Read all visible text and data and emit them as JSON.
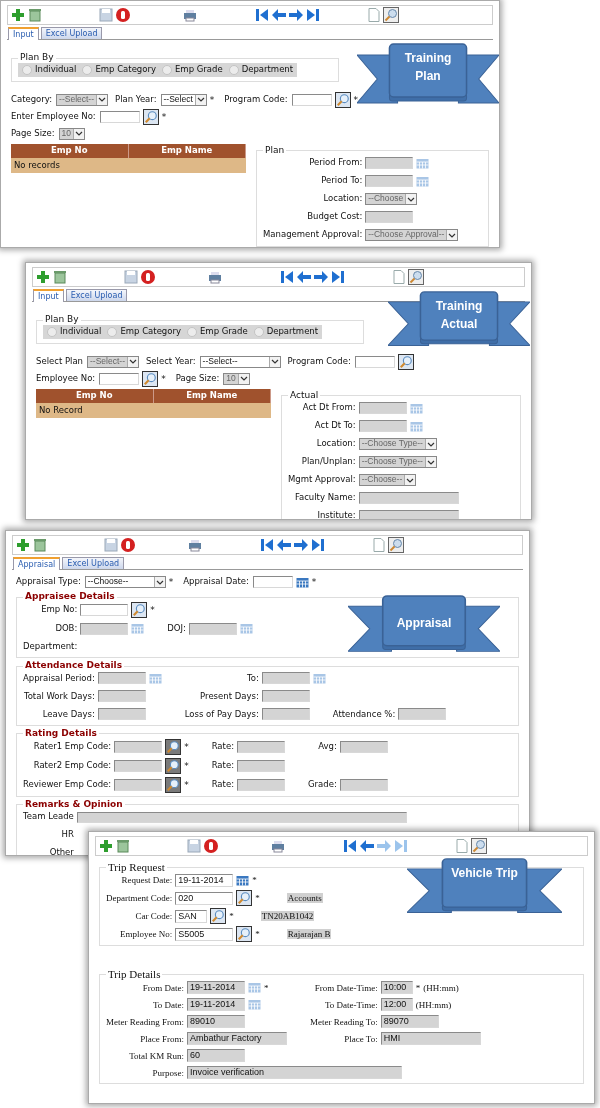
{
  "windows": [
    {
      "kind": "standard",
      "toolbar": {
        "forward_enabled": true
      },
      "tabs": [
        {
          "label": "Input",
          "selected": true
        },
        {
          "label": "Excel Upload",
          "selected": false
        }
      ],
      "ribbon": "Training Plan",
      "blocks": [
        {
          "kind": "radio-group",
          "legend": "Plan By",
          "options": [
            {
              "label": "Individual",
              "selected": false
            },
            {
              "label": "Emp Category",
              "selected": false
            },
            {
              "label": "Emp Grade",
              "selected": false
            },
            {
              "label": "Department",
              "selected": false
            }
          ]
        },
        {
          "kind": "line",
          "items": [
            {
              "kind": "label",
              "text": "Category:"
            },
            {
              "kind": "select",
              "value": "--Select--",
              "disabled": true
            },
            {
              "kind": "label",
              "text": "Plan Year:"
            },
            {
              "kind": "select",
              "value": "--Select",
              "disabled": false
            },
            {
              "kind": "mark",
              "text": "*"
            },
            {
              "kind": "label",
              "text": "Program Code:"
            },
            {
              "kind": "input",
              "disabled": false
            },
            {
              "kind": "lookup",
              "disabled": false
            },
            {
              "kind": "mark",
              "text": "*"
            }
          ]
        },
        {
          "kind": "line",
          "items": [
            {
              "kind": "label",
              "text": "Enter Employee No:"
            },
            {
              "kind": "input",
              "disabled": false
            },
            {
              "kind": "lookup",
              "disabled": false
            },
            {
              "kind": "mark",
              "text": "*"
            }
          ]
        },
        {
          "kind": "line",
          "items": [
            {
              "kind": "label",
              "text": "Page Size:"
            },
            {
              "kind": "select",
              "value": "10",
              "disabled": true
            }
          ]
        },
        {
          "kind": "split",
          "left": [
            {
              "kind": "grid",
              "columns": [
                "Emp No",
                "Emp Name"
              ],
              "empty_text": "No records"
            }
          ],
          "right": [
            {
              "kind": "fieldset",
              "legend": "Plan",
              "rows": [
                [
                  {
                    "label": "Period From:",
                    "items": [
                      {
                        "kind": "input",
                        "disabled": true
                      },
                      {
                        "kind": "calendar",
                        "disabled": true
                      }
                    ]
                  }
                ],
                [
                  {
                    "label": "Period To:",
                    "items": [
                      {
                        "kind": "input",
                        "disabled": true
                      },
                      {
                        "kind": "calendar",
                        "disabled": true
                      }
                    ]
                  }
                ],
                [
                  {
                    "label": "Location:",
                    "items": [
                      {
                        "kind": "select",
                        "value": "--Choose",
                        "disabled": true
                      }
                    ]
                  }
                ],
                [
                  {
                    "label": "Budget Cost:",
                    "items": [
                      {
                        "kind": "input",
                        "disabled": true
                      }
                    ]
                  }
                ],
                [
                  {
                    "label": "Management Approval:",
                    "items": [
                      {
                        "kind": "select",
                        "value": "--Choose Approval--",
                        "disabled": true
                      }
                    ]
                  }
                ]
              ]
            }
          ]
        }
      ]
    },
    {
      "kind": "standard",
      "toolbar": {
        "forward_enabled": true
      },
      "tabs": [
        {
          "label": "Input",
          "selected": true
        },
        {
          "label": "Excel Upload",
          "selected": false
        }
      ],
      "ribbon": "Training Actual",
      "blocks": [
        {
          "kind": "radio-group",
          "legend": "Plan By",
          "options": [
            {
              "label": "Individual",
              "selected": false
            },
            {
              "label": "Emp Category",
              "selected": false
            },
            {
              "label": "Emp Grade",
              "selected": false
            },
            {
              "label": "Department",
              "selected": false
            }
          ]
        },
        {
          "kind": "line",
          "items": [
            {
              "kind": "label",
              "text": "Select Plan"
            },
            {
              "kind": "select",
              "value": "--Select--",
              "disabled": true
            },
            {
              "kind": "label",
              "text": "Select Year:"
            },
            {
              "kind": "wide-select",
              "value": "--Select--",
              "disabled": false
            },
            {
              "kind": "label",
              "text": "Program Code:"
            },
            {
              "kind": "input",
              "disabled": false
            },
            {
              "kind": "lookup",
              "disabled": false
            }
          ]
        },
        {
          "kind": "line",
          "items": [
            {
              "kind": "label",
              "text": "Employee No:"
            },
            {
              "kind": "input",
              "disabled": false
            },
            {
              "kind": "lookup",
              "disabled": false
            },
            {
              "kind": "mark",
              "text": "*"
            },
            {
              "kind": "label",
              "text": "Page Size:"
            },
            {
              "kind": "select",
              "value": "10",
              "disabled": true
            }
          ]
        },
        {
          "kind": "split",
          "left": [
            {
              "kind": "grid",
              "columns": [
                "Emp No",
                "Emp Name"
              ],
              "empty_text": "No Record"
            }
          ],
          "right": [
            {
              "kind": "fieldset",
              "legend": "Actual",
              "rows": [
                [
                  {
                    "label": "Act Dt From:",
                    "items": [
                      {
                        "kind": "input",
                        "disabled": true
                      },
                      {
                        "kind": "calendar",
                        "disabled": true
                      }
                    ]
                  }
                ],
                [
                  {
                    "label": "Act Dt To:",
                    "items": [
                      {
                        "kind": "input",
                        "disabled": true
                      },
                      {
                        "kind": "calendar",
                        "disabled": true
                      }
                    ]
                  }
                ],
                [
                  {
                    "label": "Location:",
                    "items": [
                      {
                        "kind": "select",
                        "value": "--Choose Type--",
                        "disabled": true
                      }
                    ]
                  }
                ],
                [
                  {
                    "label": "Plan/Unplan:",
                    "items": [
                      {
                        "kind": "select",
                        "value": "--Choose Type--",
                        "disabled": true
                      }
                    ]
                  }
                ],
                [
                  {
                    "label": "Mgmt Approval:",
                    "items": [
                      {
                        "kind": "select",
                        "value": "--Choose--",
                        "disabled": true
                      }
                    ]
                  }
                ],
                [
                  {
                    "label": "Faculty Name:",
                    "items": [
                      {
                        "kind": "wide-input",
                        "disabled": true
                      }
                    ]
                  }
                ],
                [
                  {
                    "label": "Institute:",
                    "items": [
                      {
                        "kind": "wide-input",
                        "disabled": true
                      }
                    ]
                  }
                ]
              ]
            }
          ]
        }
      ]
    },
    {
      "kind": "standard",
      "toolbar": {
        "forward_enabled": true
      },
      "tabs": [
        {
          "label": "Appraisal",
          "selected": true
        },
        {
          "label": "Excel Upload",
          "selected": false
        }
      ],
      "ribbon": "Appraisal",
      "blocks": [
        {
          "kind": "line",
          "items": [
            {
              "kind": "label",
              "text": "Appraisal Type:"
            },
            {
              "kind": "wide-select",
              "value": "--Choose--",
              "disabled": false
            },
            {
              "kind": "mark",
              "text": "*"
            },
            {
              "kind": "label",
              "text": "Appraisal Date:"
            },
            {
              "kind": "input",
              "disabled": false
            },
            {
              "kind": "calendar",
              "disabled": false
            },
            {
              "kind": "mark",
              "text": "*"
            }
          ]
        },
        {
          "kind": "section",
          "legend": "Appraisee Details",
          "rows": [
            [
              {
                "label": "Emp No:",
                "items": [
                  {
                    "kind": "input",
                    "disabled": false
                  },
                  {
                    "kind": "lookup",
                    "disabled": false
                  },
                  {
                    "kind": "mark",
                    "text": "*"
                  }
                ]
              }
            ],
            [
              {
                "label": "DOB:",
                "items": [
                  {
                    "kind": "input",
                    "disabled": true
                  },
                  {
                    "kind": "calendar",
                    "disabled": true
                  }
                ]
              },
              {
                "label": "DOJ:",
                "items": [
                  {
                    "kind": "input",
                    "disabled": true
                  },
                  {
                    "kind": "calendar",
                    "disabled": true
                  }
                ]
              }
            ],
            [
              {
                "label": "Department:"
              }
            ]
          ]
        },
        {
          "kind": "section",
          "legend": "Attendance Details",
          "rows": [
            [
              {
                "label": "Appraisal Period:",
                "items": [
                  {
                    "kind": "input",
                    "disabled": true
                  },
                  {
                    "kind": "calendar",
                    "disabled": true
                  }
                ]
              },
              {
                "label": "To:",
                "items": [
                  {
                    "kind": "input",
                    "disabled": true
                  },
                  {
                    "kind": "calendar",
                    "disabled": true
                  }
                ]
              }
            ],
            [
              {
                "label": "Total Work Days:",
                "items": [
                  {
                    "kind": "input",
                    "disabled": true
                  }
                ]
              },
              {
                "label": "Present Days:",
                "items": [
                  {
                    "kind": "input",
                    "disabled": true
                  }
                ]
              }
            ],
            [
              {
                "label": "Leave Days:",
                "items": [
                  {
                    "kind": "input",
                    "disabled": true
                  }
                ]
              },
              {
                "label": "Loss of Pay Days:",
                "items": [
                  {
                    "kind": "input",
                    "disabled": true
                  }
                ]
              },
              {
                "label": "Attendance %:",
                "items": [
                  {
                    "kind": "input",
                    "disabled": true
                  }
                ]
              }
            ]
          ]
        },
        {
          "kind": "section",
          "legend": "Rating Details",
          "rows": [
            [
              {
                "label": "Rater1 Emp Code:",
                "items": [
                  {
                    "kind": "input",
                    "disabled": true
                  },
                  {
                    "kind": "lookup",
                    "disabled": true
                  },
                  {
                    "kind": "mark",
                    "text": "*"
                  }
                ]
              },
              {
                "label": "Rate:",
                "items": [
                  {
                    "kind": "input",
                    "disabled": true
                  }
                ]
              },
              {
                "label": "Avg:",
                "items": [
                  {
                    "kind": "input",
                    "disabled": true
                  }
                ]
              }
            ],
            [
              {
                "label": "Rater2 Emp Code:",
                "items": [
                  {
                    "kind": "input",
                    "disabled": true
                  },
                  {
                    "kind": "lookup",
                    "disabled": true
                  },
                  {
                    "kind": "mark",
                    "text": "*"
                  }
                ]
              },
              {
                "label": "Rate:",
                "items": [
                  {
                    "kind": "input",
                    "disabled": true
                  }
                ]
              }
            ],
            [
              {
                "label": "Reviewer Emp Code:",
                "items": [
                  {
                    "kind": "input",
                    "disabled": true
                  },
                  {
                    "kind": "lookup",
                    "disabled": true
                  },
                  {
                    "kind": "mark",
                    "text": "*"
                  }
                ]
              },
              {
                "label": "Rate:",
                "items": [
                  {
                    "kind": "input",
                    "disabled": true
                  }
                ]
              },
              {
                "label": "Grade:",
                "items": [
                  {
                    "kind": "input",
                    "disabled": true
                  }
                ]
              }
            ]
          ]
        },
        {
          "kind": "section",
          "legend": "Remarks & Opinion",
          "rows": [
            [
              {
                "label": "Team Leade",
                "items": [
                  {
                    "kind": "full-input",
                    "disabled": true
                  }
                ]
              }
            ],
            [
              {
                "label": "HR"
              }
            ],
            [
              {
                "label": "Other"
              }
            ]
          ]
        }
      ]
    },
    {
      "kind": "legacy",
      "toolbar": {
        "forward_enabled": false
      },
      "ribbon": "Vehicle Trip",
      "blocks": [
        {
          "kind": "fieldset",
          "legend": "Trip Request",
          "rows": [
            [
              {
                "label": "Request Date:",
                "items": [
                  {
                    "kind": "input",
                    "value": "19-11-2014",
                    "disabled": false
                  },
                  {
                    "kind": "calendar",
                    "disabled": false
                  },
                  {
                    "kind": "mark",
                    "text": "*"
                  }
                ]
              }
            ],
            [
              {
                "label": "Department Code:",
                "items": [
                  {
                    "kind": "input",
                    "value": "020",
                    "disabled": false
                  },
                  {
                    "kind": "lookup",
                    "disabled": false
                  },
                  {
                    "kind": "mark",
                    "text": "*"
                  },
                  {
                    "kind": "display",
                    "text": "Accounts"
                  }
                ]
              }
            ],
            [
              {
                "label": "Car Code:",
                "items": [
                  {
                    "kind": "short-input",
                    "value": "SAN",
                    "disabled": false
                  },
                  {
                    "kind": "lookup",
                    "disabled": false
                  },
                  {
                    "kind": "mark",
                    "text": "*"
                  },
                  {
                    "kind": "display",
                    "text": "TN20AB1042"
                  }
                ]
              }
            ],
            [
              {
                "label": "Employee No:",
                "items": [
                  {
                    "kind": "input",
                    "value": "S5005",
                    "disabled": false
                  },
                  {
                    "kind": "lookup",
                    "disabled": false
                  },
                  {
                    "kind": "mark",
                    "text": "*"
                  },
                  {
                    "kind": "display",
                    "text": "Rajarajan B"
                  }
                ]
              }
            ]
          ]
        },
        {
          "kind": "fieldset",
          "legend": "Trip Details",
          "rows": [
            [
              {
                "label": "From Date:",
                "items": [
                  {
                    "kind": "input",
                    "value": "19-11-2014",
                    "disabled": true
                  },
                  {
                    "kind": "calendar",
                    "disabled": true
                  },
                  {
                    "kind": "mark",
                    "text": "*"
                  }
                ]
              },
              {
                "label": "From Date-Time:",
                "items": [
                  {
                    "kind": "short-input",
                    "value": "10:00",
                    "disabled": true
                  },
                  {
                    "kind": "mark",
                    "text": "*"
                  },
                  {
                    "kind": "hint",
                    "text": "(HH:mm)"
                  }
                ]
              }
            ],
            [
              {
                "label": "To Date:",
                "items": [
                  {
                    "kind": "input",
                    "value": "19-11-2014",
                    "disabled": true
                  },
                  {
                    "kind": "calendar",
                    "disabled": true
                  }
                ]
              },
              {
                "label": "To Date-Time:",
                "items": [
                  {
                    "kind": "short-input",
                    "value": "12:00",
                    "disabled": true
                  },
                  {
                    "kind": "hint",
                    "text": "(HH:mm)"
                  }
                ]
              }
            ],
            [
              {
                "label": "Meter Reading From:",
                "items": [
                  {
                    "kind": "input",
                    "value": "89010",
                    "disabled": true
                  }
                ]
              },
              {
                "label": "Meter Reading To:",
                "items": [
                  {
                    "kind": "input",
                    "value": "89070",
                    "disabled": true
                  }
                ]
              }
            ],
            [
              {
                "label": "Place From:",
                "items": [
                  {
                    "kind": "wide-input",
                    "value": "Ambathur Factory",
                    "disabled": true
                  }
                ]
              },
              {
                "label": "Place To:",
                "items": [
                  {
                    "kind": "wide-input",
                    "value": "HMI",
                    "disabled": true
                  }
                ]
              }
            ],
            [
              {
                "label": "Total KM Run:",
                "items": [
                  {
                    "kind": "input",
                    "value": "60",
                    "disabled": true
                  }
                ]
              }
            ],
            [
              {
                "label": "Purpose:",
                "items": [
                  {
                    "kind": "long-input",
                    "value": "Invoice verification",
                    "disabled": true
                  }
                ]
              }
            ]
          ]
        }
      ]
    }
  ]
}
